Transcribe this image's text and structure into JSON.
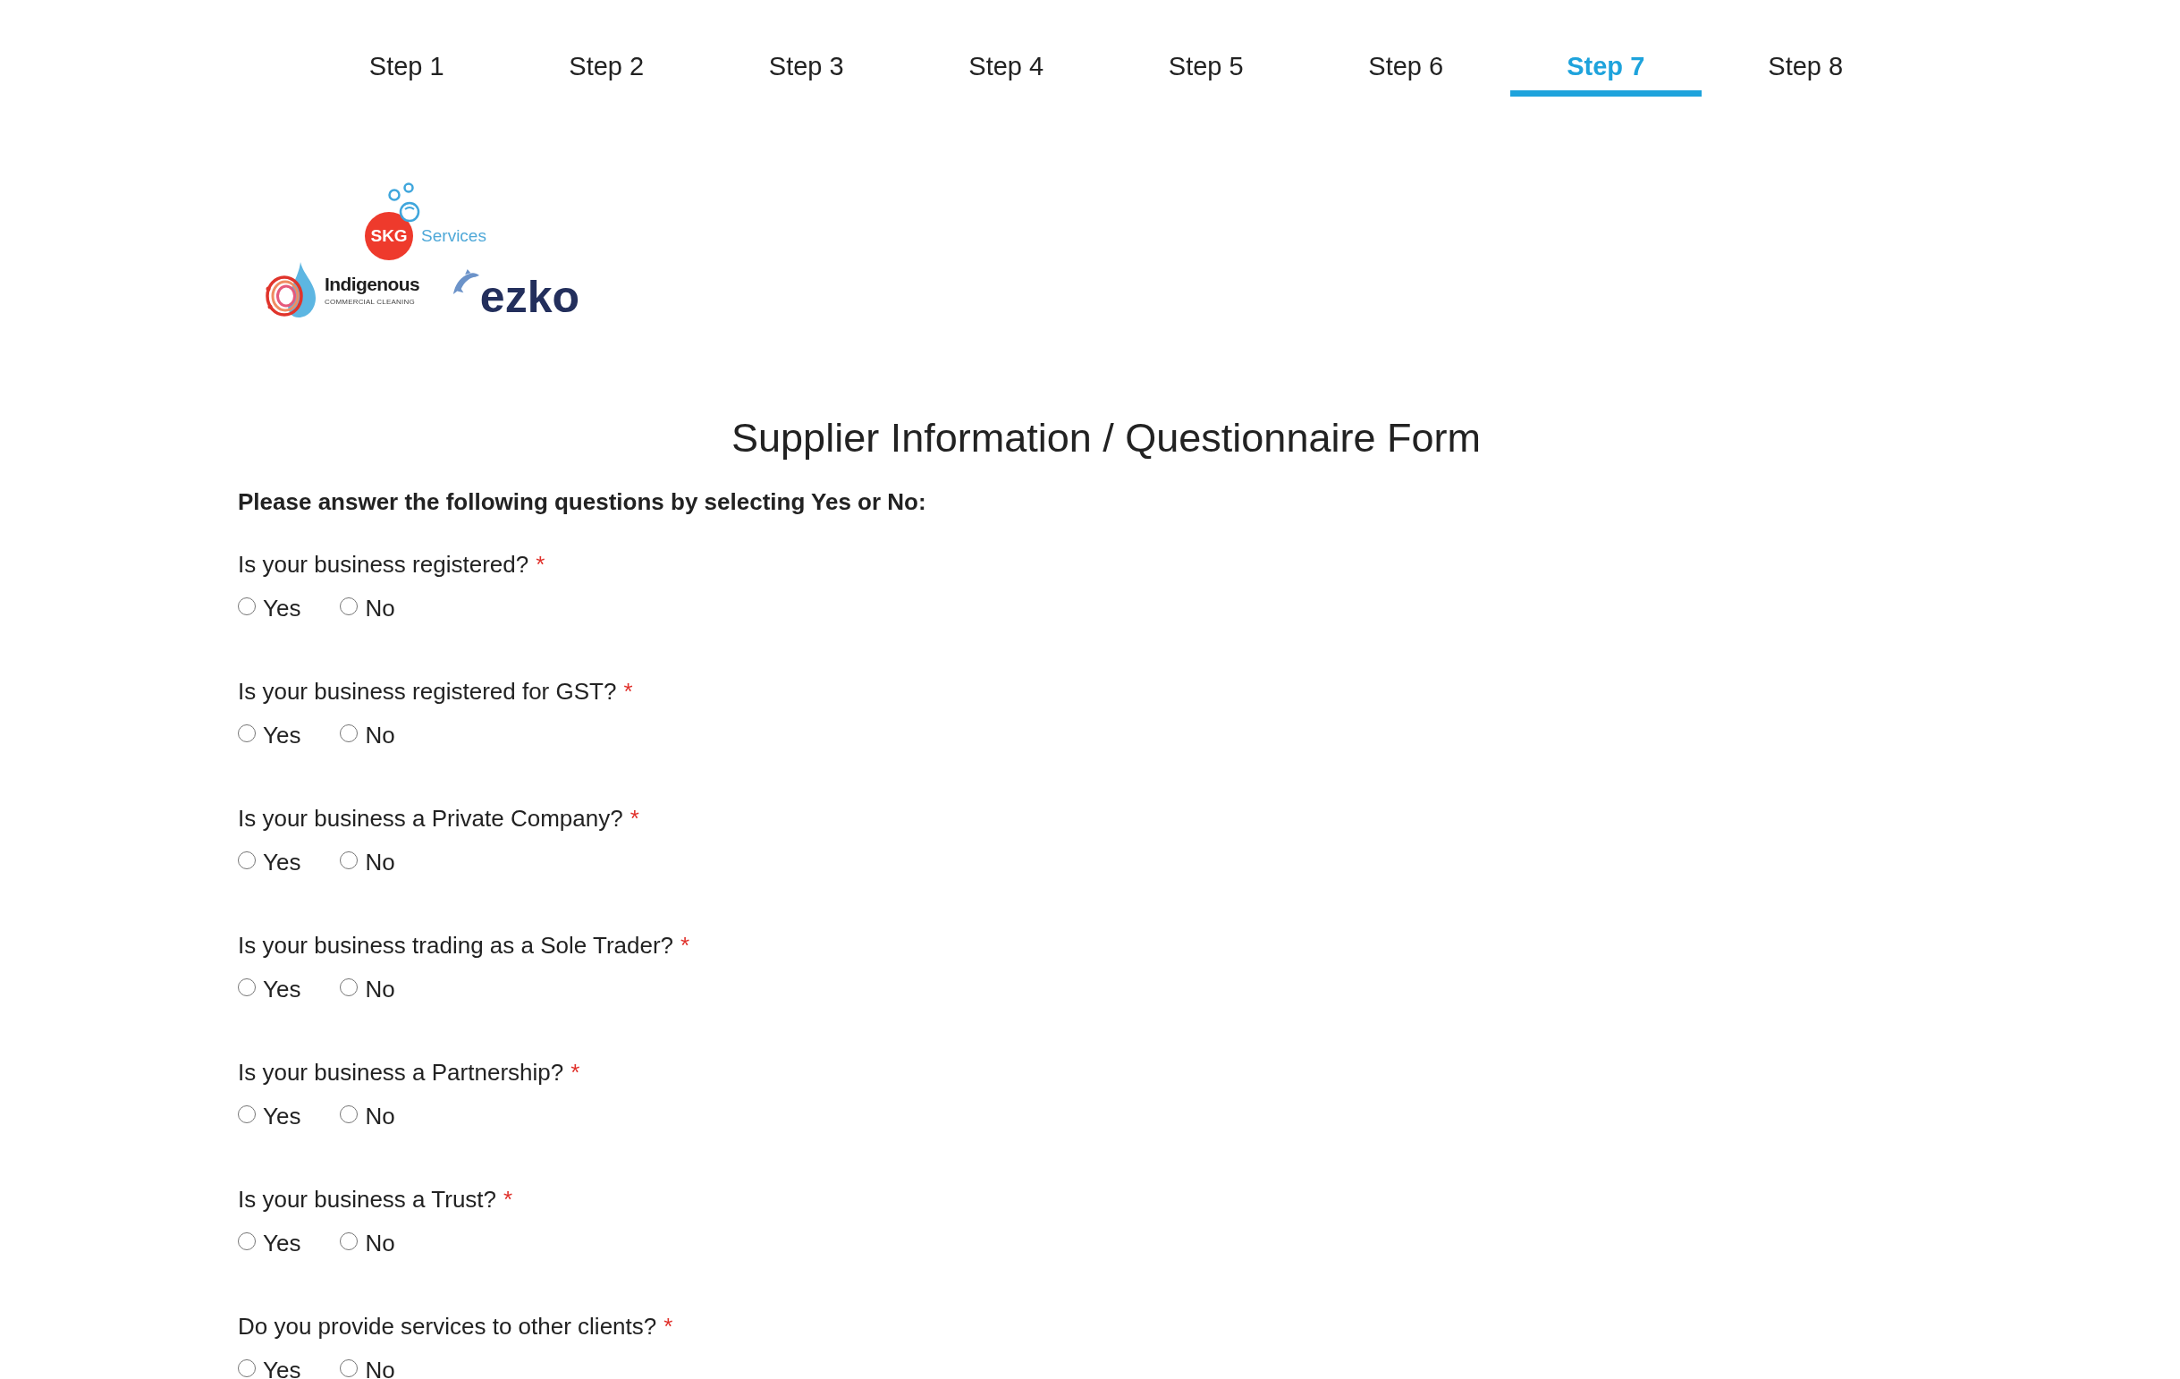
{
  "tabs": [
    {
      "label": "Step 1",
      "selected": false
    },
    {
      "label": "Step 2",
      "selected": false
    },
    {
      "label": "Step 3",
      "selected": false
    },
    {
      "label": "Step 4",
      "selected": false
    },
    {
      "label": "Step 5",
      "selected": false
    },
    {
      "label": "Step 6",
      "selected": false
    },
    {
      "label": "Step 7",
      "selected": true
    },
    {
      "label": "Step 8",
      "selected": false
    }
  ],
  "logos": {
    "skg": {
      "badge": "SKG",
      "word": "Services"
    },
    "indigenous": {
      "name": "Indigenous",
      "tagline": "COMMERCIAL CLEANING"
    },
    "ezko": {
      "name": "ezko"
    }
  },
  "form": {
    "title": "Supplier Information / Questionnaire Form",
    "instruction": "Please answer the following questions by selecting Yes or No:",
    "questions": [
      {
        "label": "Is your business registered?",
        "required_mark": "*",
        "options": [
          {
            "label": "Yes",
            "selected": false
          },
          {
            "label": "No",
            "selected": false
          }
        ]
      },
      {
        "label": "Is your business registered for GST?",
        "required_mark": "*",
        "options": [
          {
            "label": "Yes",
            "selected": false
          },
          {
            "label": "No",
            "selected": false
          }
        ]
      },
      {
        "label": "Is your business a Private Company?",
        "required_mark": "*",
        "options": [
          {
            "label": "Yes",
            "selected": false
          },
          {
            "label": "No",
            "selected": false
          }
        ]
      },
      {
        "label": "Is your business trading as a Sole Trader?",
        "required_mark": "*",
        "options": [
          {
            "label": "Yes",
            "selected": false
          },
          {
            "label": "No",
            "selected": false
          }
        ]
      },
      {
        "label": "Is your business a Partnership?",
        "required_mark": "*",
        "options": [
          {
            "label": "Yes",
            "selected": false
          },
          {
            "label": "No",
            "selected": false
          }
        ]
      },
      {
        "label": "Is your business a Trust?",
        "required_mark": "*",
        "options": [
          {
            "label": "Yes",
            "selected": false
          },
          {
            "label": "No",
            "selected": false
          }
        ]
      },
      {
        "label": "Do you provide services to other clients?",
        "required_mark": "*",
        "options": [
          {
            "label": "Yes",
            "selected": false
          },
          {
            "label": "No",
            "selected": false
          }
        ]
      }
    ]
  }
}
